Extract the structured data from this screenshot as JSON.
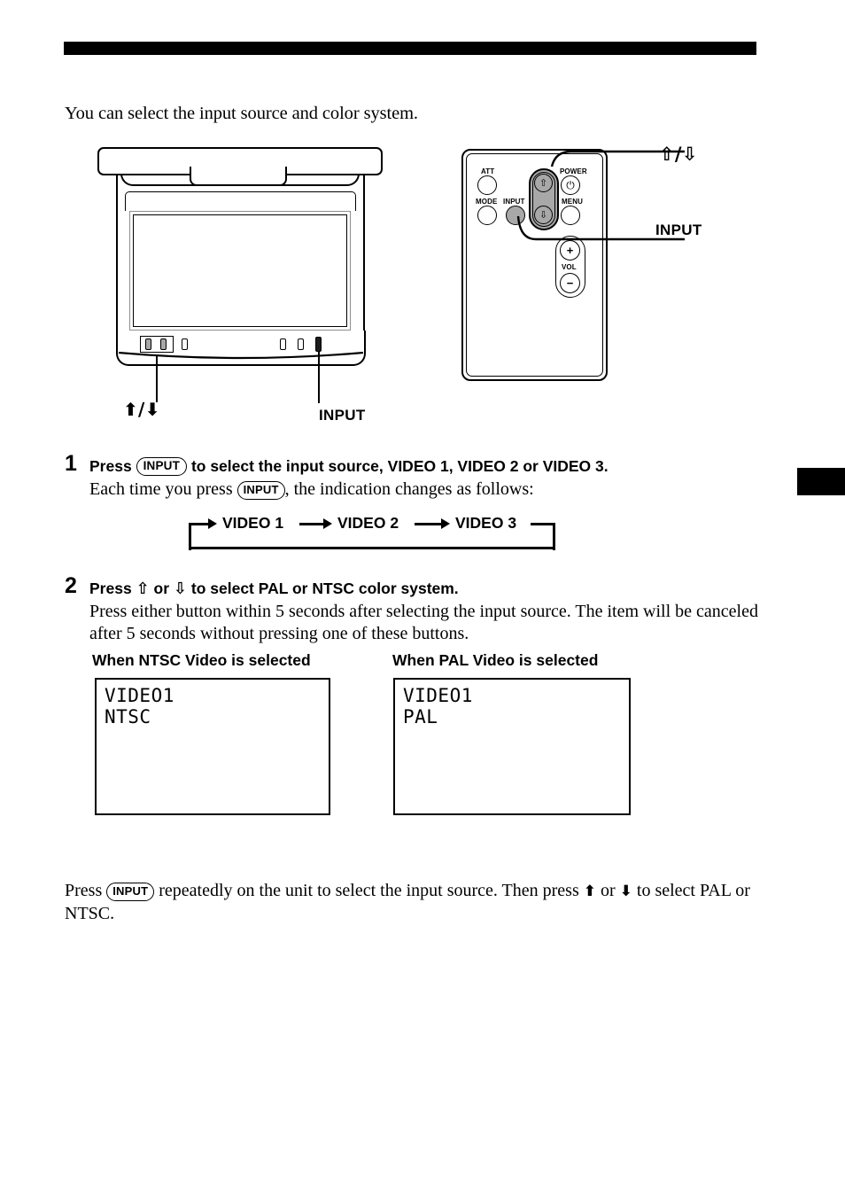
{
  "page": {
    "intro": "You can select the input source and color system."
  },
  "figures": {
    "monitor": {
      "name": "flip-down-monitor",
      "updown_label": "⬆/⬇",
      "input_label": "INPUT"
    },
    "remote": {
      "name": "remote-commander",
      "buttons": {
        "att": "ATT",
        "mode": "MODE",
        "input": "INPUT",
        "power": "POWER",
        "menu": "MENU",
        "vol": "VOL",
        "vol_plus": "+",
        "vol_minus": "−",
        "power_glyph": "⏻",
        "up_glyph": "⇧",
        "down_glyph": "⇩"
      },
      "callout_updown": "⇧/⇩",
      "callout_input": "INPUT"
    }
  },
  "steps": [
    {
      "number": "1",
      "head_pre": "Press",
      "head_pill": "INPUT",
      "head_post": "to select the input source, VIDEO 1, VIDEO 2 or VIDEO 3.",
      "body_pre": "Each time you press",
      "body_pill": "INPUT",
      "body_post": ", the indication changes as follows:"
    },
    {
      "number": "2",
      "head_pre": "Press",
      "head_up": "⇧",
      "head_mid": "or",
      "head_down": "⇩",
      "head_post": "to select PAL or NTSC color system.",
      "body": "Press either button within 5 seconds after selecting the input source. The item will be canceled after 5 seconds without pressing one of these buttons."
    }
  ],
  "cycle": {
    "items": [
      "VIDEO 1",
      "VIDEO 2",
      "VIDEO 3"
    ]
  },
  "osd": [
    {
      "heading": "When NTSC Video is selected",
      "line1": "VIDEO1",
      "line2": "NTSC"
    },
    {
      "heading": "When PAL Video is selected",
      "line1": "VIDEO1",
      "line2": "PAL"
    }
  ],
  "closing": {
    "pre": "Press",
    "pill": "INPUT",
    "mid": "repeatedly on the unit to select the input source. Then press",
    "up": "⬆",
    "or": "or",
    "down": "⬇",
    "post": "to select PAL or NTSC."
  }
}
